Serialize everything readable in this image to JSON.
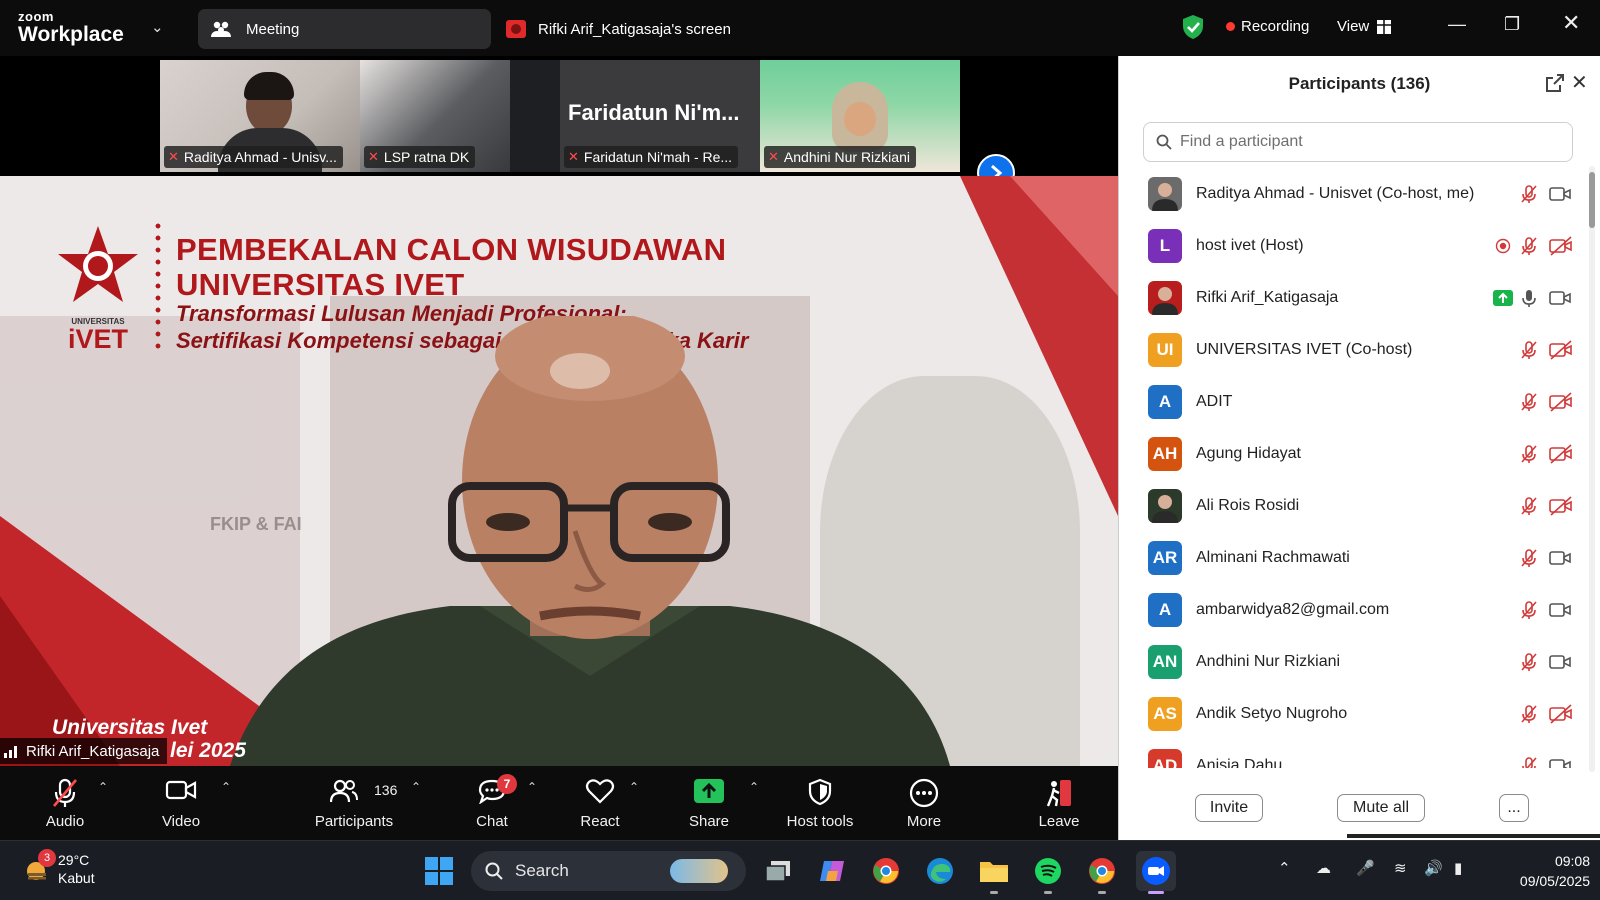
{
  "titlebar": {
    "logo_line1": "zoom",
    "logo_line2": "Workplace",
    "meeting_tab": "Meeting",
    "screen_tab": "Rifki Arif_Katigasaja's screen",
    "recording": "Recording",
    "view": "View"
  },
  "thumbnails": [
    {
      "name": "Raditya Ahmad - Unisv..."
    },
    {
      "name": "LSP ratna DK"
    },
    {
      "name": "Faridatun Ni'mah - Re...",
      "big_name": "Faridatun Ni'm..."
    },
    {
      "name": "Andhini Nur Rizkiani"
    }
  ],
  "slide": {
    "title_line1": "PEMBEKALAN CALON WISUDAWAN",
    "title_line2": "UNIVERSITAS IVET",
    "subtitle_line1": "Transformasi Lulusan Menjadi Profesional:",
    "subtitle_line2": "Sertifikasi Kompetensi sebagai J",
    "subtitle_line2b": "buka Karir",
    "logo_small": "UNIVERSITAS",
    "logo_word": "iVET",
    "footer_line1": "Universitas Ivet",
    "footer_line2": "lei 2025",
    "building_text": "FKIP & FAI"
  },
  "speaker_label": "Rifki Arif_Katigasaja",
  "toolbar": {
    "audio": "Audio",
    "video": "Video",
    "participants": "Participants",
    "participants_count": "136",
    "chat": "Chat",
    "chat_badge": "7",
    "react": "React",
    "share": "Share",
    "host_tools": "Host tools",
    "more": "More",
    "leave": "Leave"
  },
  "panel": {
    "title": "Participants (136)",
    "search_placeholder": "Find a participant",
    "invite": "Invite",
    "mute_all": "Mute all",
    "more": "..."
  },
  "participants": [
    {
      "initials": "",
      "name": "Raditya Ahmad - Unisvet (Co-host, me)",
      "color": "#6b6b6b",
      "photo": true,
      "mic": "off",
      "video": "on"
    },
    {
      "initials": "L",
      "name": "host ivet (Host)",
      "color": "#7a2fb8",
      "recording": true,
      "mic": "off",
      "video": "off"
    },
    {
      "initials": "",
      "name": "Rifki Arif_Katigasaja",
      "color": "#b81e1e",
      "photo": true,
      "sharing": true,
      "mic": "on",
      "video": "on"
    },
    {
      "initials": "UI",
      "name": "UNIVERSITAS IVET (Co-host)",
      "color": "#f0a020",
      "mic": "off",
      "video": "off"
    },
    {
      "initials": "A",
      "name": "ADIT",
      "color": "#1f6fc5",
      "mic": "off",
      "video": "off"
    },
    {
      "initials": "AH",
      "name": "Agung Hidayat",
      "color": "#d4530f",
      "mic": "off",
      "video": "off"
    },
    {
      "initials": "",
      "name": "Ali Rois Rosidi",
      "color": "#2b3a2b",
      "photo": true,
      "mic": "off",
      "video": "off"
    },
    {
      "initials": "AR",
      "name": "Alminani Rachmawati",
      "color": "#1f6fc5",
      "mic": "off",
      "video": "on"
    },
    {
      "initials": "A",
      "name": "ambarwidya82@gmail.com",
      "color": "#1f6fc5",
      "mic": "off",
      "video": "on"
    },
    {
      "initials": "AN",
      "name": "Andhini Nur Rizkiani",
      "color": "#19a06e",
      "mic": "off",
      "video": "on"
    },
    {
      "initials": "AS",
      "name": "Andik Setyo Nugroho",
      "color": "#f0a020",
      "mic": "off",
      "video": "off"
    },
    {
      "initials": "AD",
      "name": "Anisia Dahu",
      "color": "#d63a2a",
      "mic": "off",
      "video": "on"
    }
  ],
  "taskbar": {
    "weather_temp": "29°C",
    "weather_desc": "Kabut",
    "weather_badge": "3",
    "search": "Search",
    "time": "09:08",
    "date": "09/05/2025"
  }
}
